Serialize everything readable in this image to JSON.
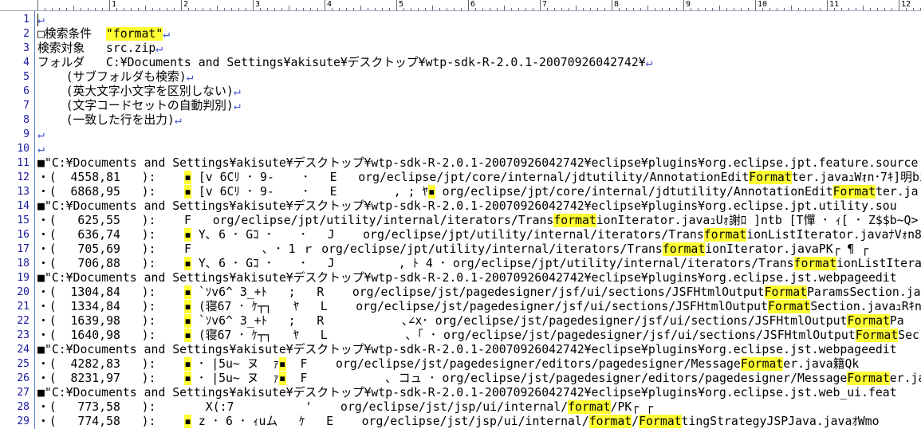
{
  "colors": {
    "highlight": "#ffff33",
    "eol_mark": "#4a5bd6",
    "line_number": "#1a1aa0",
    "gutter_border": "#5a7bd8"
  },
  "ruler": {
    "labels": [
      "1",
      "2",
      "3",
      "4",
      "5",
      "6",
      "7",
      "8",
      "9",
      "10",
      "11",
      "12"
    ]
  },
  "editor": {
    "lines": [
      {
        "num": "1",
        "segs": [
          {
            "t": "↵",
            "c": "eol"
          }
        ]
      },
      {
        "num": "2",
        "segs": [
          {
            "t": "□検索条件  "
          },
          {
            "t": "\"format\"",
            "c": "hl"
          },
          {
            "t": "↵",
            "c": "eol"
          }
        ]
      },
      {
        "num": "3",
        "segs": [
          {
            "t": "検索対象   src.zip"
          },
          {
            "t": "↵",
            "c": "eol"
          }
        ]
      },
      {
        "num": "4",
        "segs": [
          {
            "t": "フォルダ   C:¥Documents and Settings¥akisute¥デスクトップ¥wtp-sdk-R-2.0.1-20070926042742¥"
          },
          {
            "t": "↵",
            "c": "eol"
          }
        ]
      },
      {
        "num": "5",
        "segs": [
          {
            "t": "    (サブフォルダも検索)"
          },
          {
            "t": "↵",
            "c": "eol"
          }
        ]
      },
      {
        "num": "6",
        "segs": [
          {
            "t": "    (英大文字小文字を区別しない)"
          },
          {
            "t": "↵",
            "c": "eol"
          }
        ]
      },
      {
        "num": "7",
        "segs": [
          {
            "t": "    (文字コードセットの自動判別)"
          },
          {
            "t": "↵",
            "c": "eol"
          }
        ]
      },
      {
        "num": "8",
        "segs": [
          {
            "t": "    (一致した行を出力)"
          },
          {
            "t": "↵",
            "c": "eol"
          }
        ]
      },
      {
        "num": "9",
        "segs": [
          {
            "t": "↵",
            "c": "eol"
          }
        ]
      },
      {
        "num": "10",
        "segs": [
          {
            "t": "↵",
            "c": "eol"
          }
        ]
      },
      {
        "num": "11",
        "segs": [
          {
            "t": "■\"C:¥Documents and Settings¥akisute¥デスクトップ¥wtp-sdk-R-2.0.1-20070926042742¥eclipse¥plugins¥org.eclipse.jpt.feature.source"
          }
        ]
      },
      {
        "num": "12",
        "segs": [
          {
            "t": "・(  4558,81   ):    "
          },
          {
            "t": "▪",
            "c": "hl"
          },
          {
            "t": " [v 6Cﾘ ･ 9-    ･   E   org/eclipse/jpt/core/internal/jdtutility/AnnotationEdit"
          },
          {
            "t": "Format",
            "c": "hl"
          },
          {
            "t": "ter.javaｭWｫn･7ｷ]明bi"
          }
        ]
      },
      {
        "num": "13",
        "segs": [
          {
            "t": "・(  6868,95   ):    "
          },
          {
            "t": "▪",
            "c": "hl"
          },
          {
            "t": " [v 6Cﾘ ･ 9-    ･   E        , ; ﾔ"
          },
          {
            "t": "▪",
            "c": "hl"
          },
          {
            "t": " org/eclipse/jpt/core/internal/jdtutility/AnnotationEdit"
          },
          {
            "t": "Format",
            "c": "hl"
          },
          {
            "t": "ter.ja"
          }
        ]
      },
      {
        "num": "14",
        "segs": [
          {
            "t": "■\"C:¥Documents and Settings¥akisute¥デスクトップ¥wtp-sdk-R-2.0.1-20070926042742¥eclipse¥plugins¥org.eclipse.jpt.utility.sou"
          }
        ]
      },
      {
        "num": "15",
        "segs": [
          {
            "t": "・(   625,55   ):    F   org/eclipse/jpt/utility/internal/iterators/Trans"
          },
          {
            "t": "format",
            "c": "hl"
          },
          {
            "t": "ionIterator.javaｭUｫ謝ﾛ ]ntb [T憚 ･ ｨ[ ･ Z$$b~Q>"
          }
        ]
      },
      {
        "num": "16",
        "segs": [
          {
            "t": "・(   636,74   ):    "
          },
          {
            "t": "▪",
            "c": "hl"
          },
          {
            "t": " Y､ 6 ･ Gｺ ･    ･   J    org/eclipse/jpt/utility/internal/iterators/Trans"
          },
          {
            "t": "format",
            "c": "hl"
          },
          {
            "t": "ionListIterator.javaﾅVｫn8"
          }
        ]
      },
      {
        "num": "17",
        "segs": [
          {
            "t": "・(   705,69   ):    F          ､ ･ 1 ｒ org/eclipse/jpt/utility/internal/iterators/Trans"
          },
          {
            "t": "format",
            "c": "hl"
          },
          {
            "t": "ionIterator.javaPK┌ ¶ ┌"
          }
        ]
      },
      {
        "num": "18",
        "segs": [
          {
            "t": "・(   706,88   ):    "
          },
          {
            "t": "▪",
            "c": "hl"
          },
          {
            "t": " Y､ 6 ･ Gｺ ･    ･   J         , ﾄ 4 ･ org/eclipse/jpt/utility/internal/iterators/Trans"
          },
          {
            "t": "format",
            "c": "hl"
          },
          {
            "t": "ionListItera"
          }
        ]
      },
      {
        "num": "19",
        "segs": [
          {
            "t": "■\"C:¥Documents and Settings¥akisute¥デスクトップ¥wtp-sdk-R-2.0.1-20070926042742¥eclipse¥plugins¥org.eclipse.jst.webpageedit"
          }
        ]
      },
      {
        "num": "20",
        "segs": [
          {
            "t": "・(  1304,84   ):    "
          },
          {
            "t": "▪",
            "c": "hl"
          },
          {
            "t": " `ｿv6^ 3_+ﾄ   ;   R    org/eclipse/jst/pagedesigner/jsf/ui/sections/JSFHtmlOutput"
          },
          {
            "t": "Format",
            "c": "hl"
          },
          {
            "t": "ParamsSection.jav"
          }
        ]
      },
      {
        "num": "21",
        "segs": [
          {
            "t": "・(  1334,84   ):    "
          },
          {
            "t": "▪",
            "c": "hl"
          },
          {
            "t": " (寝67 ･ ｹ┬┐   ﾔ   L    org/eclipse/jst/pagedesigner/jsf/ui/sections/JSFHtmlOutput"
          },
          {
            "t": "Format",
            "c": "hl"
          },
          {
            "t": "Section.javaｭRｷn"
          }
        ]
      },
      {
        "num": "22",
        "segs": [
          {
            "t": "・(  1639,98   ):    "
          },
          {
            "t": "▪",
            "c": "hl"
          },
          {
            "t": " `ｿv6^ 3_+ﾄ   ;   R           ､∠x･ org/eclipse/jst/pagedesigner/jsf/ui/sections/JSFHtmlOutput"
          },
          {
            "t": "Format",
            "c": "hl"
          },
          {
            "t": "Pa"
          }
        ]
      },
      {
        "num": "23",
        "segs": [
          {
            "t": "・(  1640,98   ):    "
          },
          {
            "t": "▪",
            "c": "hl"
          },
          {
            "t": " (寝67 ･ ｹ┬┐   ﾔ   L           ､「 ･ org/eclipse/jst/pagedesigner/jsf/ui/sections/JSFHtmlOutput"
          },
          {
            "t": "Format",
            "c": "hl"
          },
          {
            "t": "Sec"
          }
        ]
      },
      {
        "num": "24",
        "segs": [
          {
            "t": "■\"C:¥Documents and Settings¥akisute¥デスクトップ¥wtp-sdk-R-2.0.1-20070926042742¥eclipse¥plugins¥org.eclipse.jst.webpageedit"
          }
        ]
      },
      {
        "num": "25",
        "segs": [
          {
            "t": "・(  4282,83   ):    "
          },
          {
            "t": "▪",
            "c": "hl"
          },
          {
            "t": " ･ |5u~ ヌ  ｧ"
          },
          {
            "t": "▪",
            "c": "hl"
          },
          {
            "t": "  F    org/eclipse/jst/pagedesigner/editors/pagedesigner/Message"
          },
          {
            "t": "Format",
            "c": "hl"
          },
          {
            "t": "er.java籍Qk"
          }
        ]
      },
      {
        "num": "26",
        "segs": [
          {
            "t": "・(  8231,97   ):    "
          },
          {
            "t": "▪",
            "c": "hl"
          },
          {
            "t": " ･ |5u~ ヌ  ｧ"
          },
          {
            "t": "▪",
            "c": "hl"
          },
          {
            "t": "  F           ､ コュ ･ org/eclipse/jst/pagedesigner/editors/pagedesigner/Message"
          },
          {
            "t": "Format",
            "c": "hl"
          },
          {
            "t": "er.ja"
          }
        ]
      },
      {
        "num": "27",
        "segs": [
          {
            "t": "■\"C:¥Documents and Settings¥akisute¥デスクトップ¥wtp-sdk-R-2.0.1-20070926042742¥eclipse¥plugins¥org.eclipse.jst.web_ui.feat"
          }
        ]
      },
      {
        "num": "28",
        "segs": [
          {
            "t": "・(   773,58   ):       X(:7          '    org/eclipse/jst/jsp/ui/internal/"
          },
          {
            "t": "format",
            "c": "hl"
          },
          {
            "t": "/PK┌ ┌"
          }
        ]
      },
      {
        "num": "29",
        "segs": [
          {
            "t": "・(   774,58   ):    "
          },
          {
            "t": "▪",
            "c": "hl"
          },
          {
            "t": " z ･ 6 ･ ｨuム   ｹ   E    org/eclipse/jst/jsp/ui/internal/"
          },
          {
            "t": "format",
            "c": "hl"
          },
          {
            "t": "/"
          },
          {
            "t": "Format",
            "c": "hl"
          },
          {
            "t": "tingStrategyJSPJava.javaｵWmo"
          }
        ]
      }
    ]
  }
}
